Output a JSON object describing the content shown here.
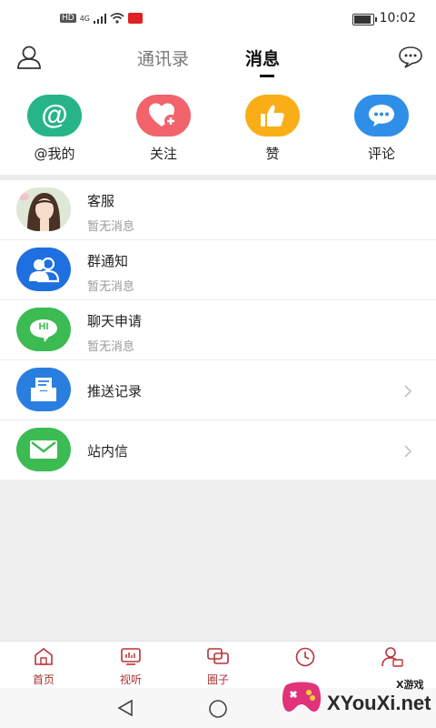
{
  "status_bar": {
    "network_badge": "HD",
    "signal_label": "4G",
    "battery_level_pct": 90,
    "time": "10:02"
  },
  "header": {
    "tabs": [
      {
        "label": "通讯录",
        "active": false
      },
      {
        "label": "消息",
        "active": true
      }
    ],
    "left_icon": "user-icon",
    "right_icon": "chat-bubble-icon"
  },
  "quick_actions": [
    {
      "label": "@我的",
      "icon": "at-icon",
      "color": "#27b588"
    },
    {
      "label": "关注",
      "icon": "heart-plus-icon",
      "color": "#f2636c"
    },
    {
      "label": "赞",
      "icon": "thumbs-up-icon",
      "color": "#f9ae17"
    },
    {
      "label": "评论",
      "icon": "comment-icon",
      "color": "#2f8fe8"
    }
  ],
  "messages": [
    {
      "title": "客服",
      "subtitle": "暂无消息",
      "icon": "customer-service-avatar"
    },
    {
      "title": "群通知",
      "subtitle": "暂无消息",
      "icon": "group-icon",
      "color": "#1e6fe0"
    },
    {
      "title": "聊天申请",
      "subtitle": "暂无消息",
      "icon": "hi-chat-icon",
      "color": "#3bbb52",
      "icon_text": "HI"
    }
  ],
  "links": [
    {
      "title": "推送记录",
      "icon": "push-inbox-icon",
      "color": "#2a7ee0"
    },
    {
      "title": "站内信",
      "icon": "mail-icon",
      "color": "#3bbb52"
    }
  ],
  "bottom_nav": [
    {
      "label": "首页",
      "icon": "home-icon"
    },
    {
      "label": "视听",
      "icon": "media-icon"
    },
    {
      "label": "圈子",
      "icon": "circle-icon"
    },
    {
      "label": "",
      "icon": "clock-icon"
    },
    {
      "label": "",
      "icon": "profile-icon"
    }
  ],
  "watermark": {
    "text": "XYouXi.net",
    "small": "X游戏"
  },
  "accent_color": "#b8323a"
}
